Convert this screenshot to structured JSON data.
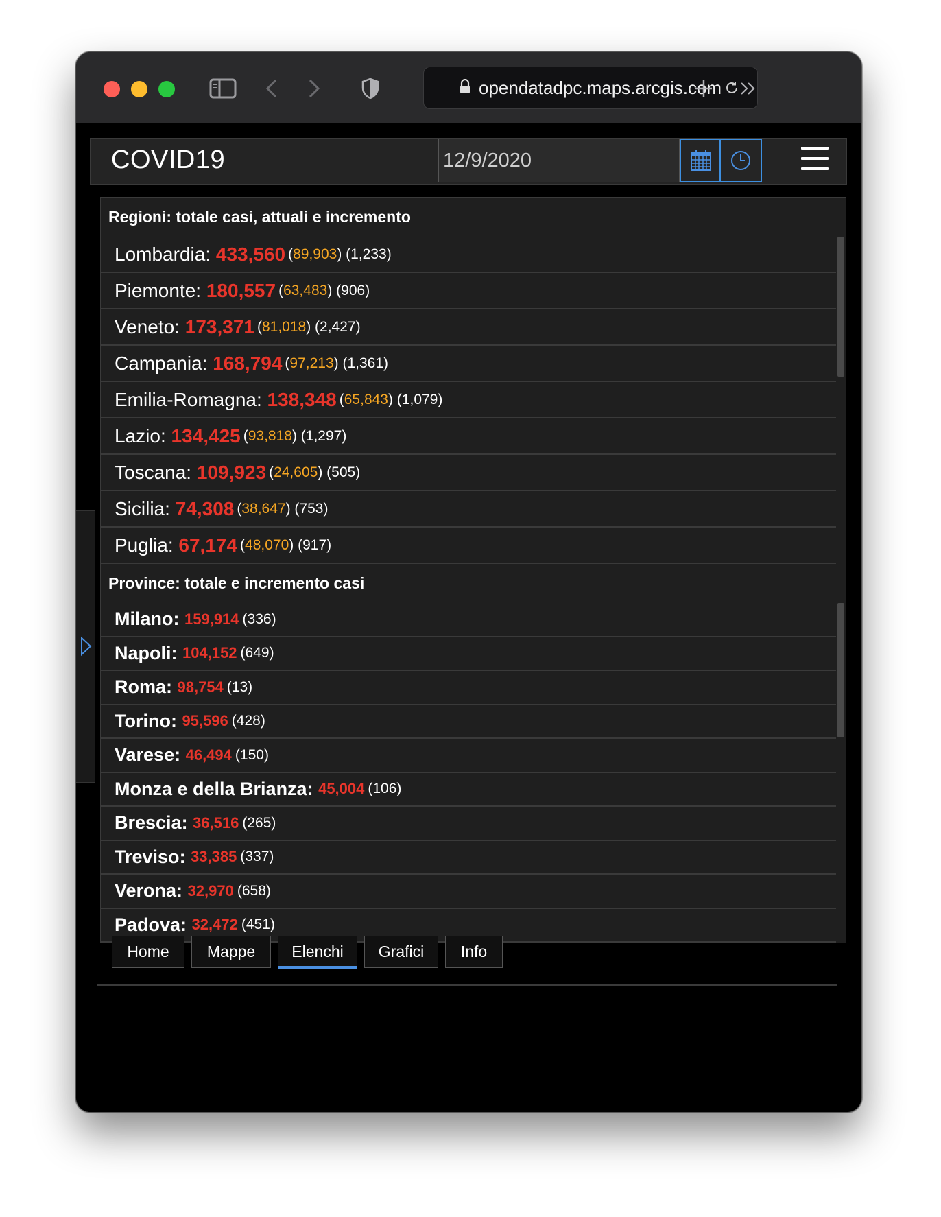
{
  "browser": {
    "url": "opendatadpc.maps.arcgis.com"
  },
  "app": {
    "title": "COVID19",
    "date_value": "12/9/2020"
  },
  "regions": {
    "title": "Regioni: totale casi, attuali e incremento",
    "items": [
      {
        "name": "Lombardia",
        "total": "433,560",
        "current": "89,903",
        "increment": "1,233"
      },
      {
        "name": "Piemonte",
        "total": "180,557",
        "current": "63,483",
        "increment": "906"
      },
      {
        "name": "Veneto",
        "total": "173,371",
        "current": "81,018",
        "increment": "2,427"
      },
      {
        "name": "Campania",
        "total": "168,794",
        "current": "97,213",
        "increment": "1,361"
      },
      {
        "name": "Emilia-Romagna",
        "total": "138,348",
        "current": "65,843",
        "increment": "1,079"
      },
      {
        "name": "Lazio",
        "total": "134,425",
        "current": "93,818",
        "increment": "1,297"
      },
      {
        "name": "Toscana",
        "total": "109,923",
        "current": "24,605",
        "increment": "505"
      },
      {
        "name": "Sicilia",
        "total": "74,308",
        "current": "38,647",
        "increment": "753"
      },
      {
        "name": "Puglia",
        "total": "67,174",
        "current": "48,070",
        "increment": "917"
      }
    ]
  },
  "provinces": {
    "title": "Province: totale e incremento casi",
    "items": [
      {
        "name": "Milano",
        "total": "159,914",
        "increment": "336"
      },
      {
        "name": "Napoli",
        "total": "104,152",
        "increment": "649"
      },
      {
        "name": "Roma",
        "total": "98,754",
        "increment": "13"
      },
      {
        "name": "Torino",
        "total": "95,596",
        "increment": "428"
      },
      {
        "name": "Varese",
        "total": "46,494",
        "increment": "150"
      },
      {
        "name": "Monza e della Brianza",
        "total": "45,004",
        "increment": "106"
      },
      {
        "name": "Brescia",
        "total": "36,516",
        "increment": "265"
      },
      {
        "name": "Treviso",
        "total": "33,385",
        "increment": "337"
      },
      {
        "name": "Verona",
        "total": "32,970",
        "increment": "658"
      },
      {
        "name": "Padova",
        "total": "32,472",
        "increment": "451"
      }
    ]
  },
  "tabs": [
    {
      "label": "Home",
      "active": false
    },
    {
      "label": "Mappe",
      "active": false
    },
    {
      "label": "Elenchi",
      "active": true
    },
    {
      "label": "Grafici",
      "active": false
    },
    {
      "label": "Info",
      "active": false
    }
  ],
  "colors": {
    "total": "#e8352b",
    "current": "#f5a623",
    "accent": "#4a90e2"
  }
}
